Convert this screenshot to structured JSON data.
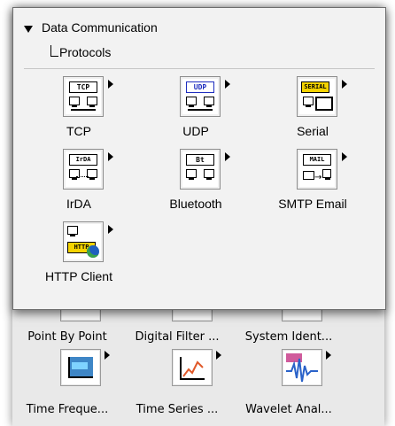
{
  "popup": {
    "category": "Data Communication",
    "subcategory": "Protocols",
    "items": [
      {
        "label": "TCP",
        "icon": "tcp-icon",
        "tag": "TCP"
      },
      {
        "label": "UDP",
        "icon": "udp-icon",
        "tag": "UDP"
      },
      {
        "label": "Serial",
        "icon": "serial-icon",
        "tag": "SERIAL"
      },
      {
        "label": "IrDA",
        "icon": "irda-icon",
        "tag": "IrDA"
      },
      {
        "label": "Bluetooth",
        "icon": "bluetooth-icon",
        "tag": "Bt"
      },
      {
        "label": "SMTP Email",
        "icon": "smtp-email-icon",
        "tag": "MAIL"
      },
      {
        "label": "HTTP Client",
        "icon": "http-client-icon",
        "tag": "HTTP"
      }
    ]
  },
  "background_palette": {
    "items": [
      {
        "label": "Point By Point"
      },
      {
        "label": "Digital Filter ..."
      },
      {
        "label": "System Ident..."
      },
      {
        "label": "Time Freque..."
      },
      {
        "label": "Time Series ..."
      },
      {
        "label": "Wavelet Anal..."
      }
    ]
  },
  "colors": {
    "popup_bg": "#f2f2f2",
    "serial_tag_bg": "#f5d300",
    "udp_tag_color": "#1e2dbf",
    "accent_blue": "#1f5fbf"
  }
}
